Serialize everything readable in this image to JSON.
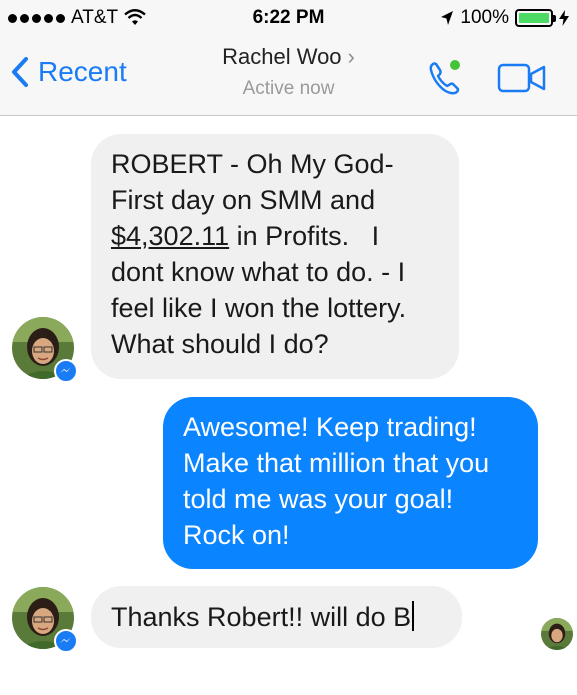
{
  "status_bar": {
    "carrier": "AT&T",
    "time": "6:22 PM",
    "battery": "100%",
    "battery_level": 1.0
  },
  "nav": {
    "back_label": "Recent",
    "contact_name": "Rachel Woo",
    "contact_status": "Active now",
    "accent_color": "#1a7cf5"
  },
  "messages": {
    "m1": {
      "sender": "incoming",
      "line1": "ROBERT  - Oh My God-",
      "line2": "First day on SMM and",
      "amount": "$4,302.11",
      "line3_rest": " in Profits.   I",
      "line4": "dont know what to do. - I",
      "line5": "feel like I won the lottery.",
      "line6": "What should I do?"
    },
    "m2": {
      "sender": "outgoing",
      "line1": "Awesome! Keep trading!",
      "line2": "Make that million that you",
      "line3": "told me was your goal!",
      "line4": "Rock on!"
    },
    "m3": {
      "sender": "incoming",
      "text": "Thanks Robert!! will do B"
    }
  },
  "colors": {
    "outgoing_bubble": "#0a84ff",
    "incoming_bubble": "#f0f0f0"
  }
}
